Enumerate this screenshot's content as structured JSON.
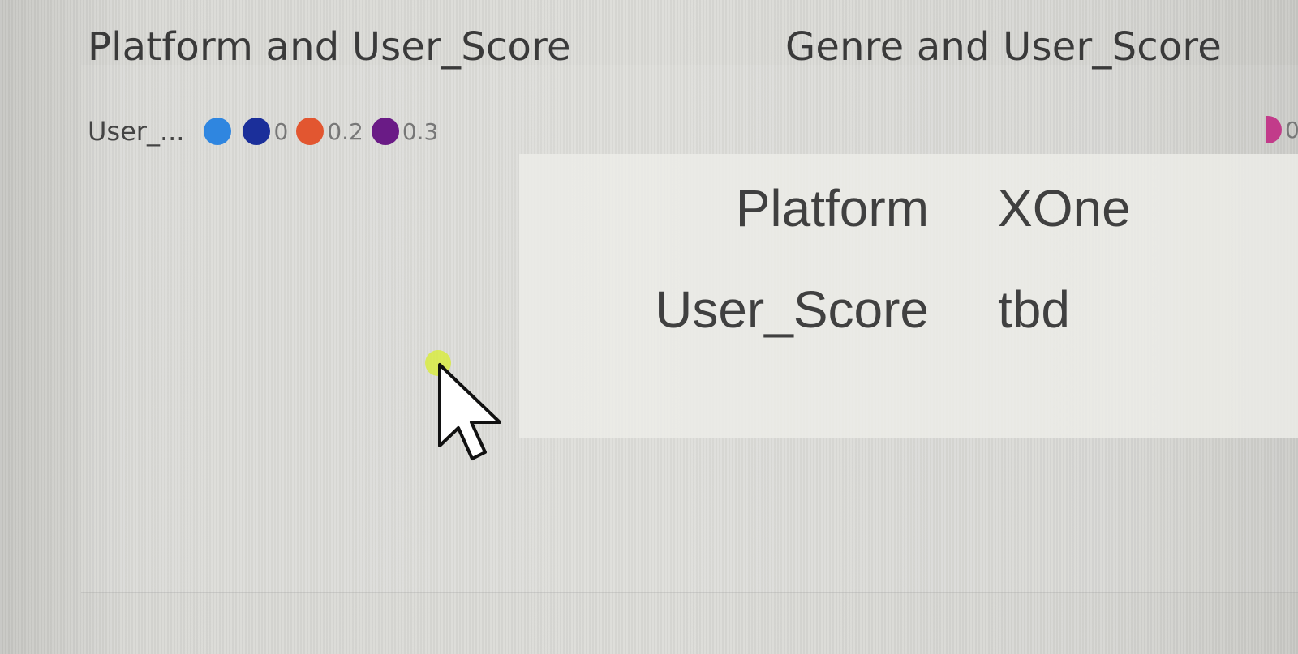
{
  "visuals": {
    "left_title": "Platform and User_Score",
    "right_title": "Genre and User_Score"
  },
  "legend": {
    "title": "User_...",
    "items": [
      {
        "label": "",
        "color": "#2f86e0"
      },
      {
        "label": "0",
        "color": "#1b2f9a"
      },
      {
        "label": "0.2",
        "color": "#e25630"
      },
      {
        "label": "0.3",
        "color": "#6a1b86"
      }
    ],
    "right_clipped": {
      "label": "0",
      "color": "#c23b8a"
    }
  },
  "tooltip": {
    "rows": [
      {
        "key": "Platform",
        "value": "XOne"
      },
      {
        "key": "User_Score",
        "value": "tbd"
      }
    ]
  },
  "icons": {
    "cursor": "mouse-pointer-icon"
  }
}
